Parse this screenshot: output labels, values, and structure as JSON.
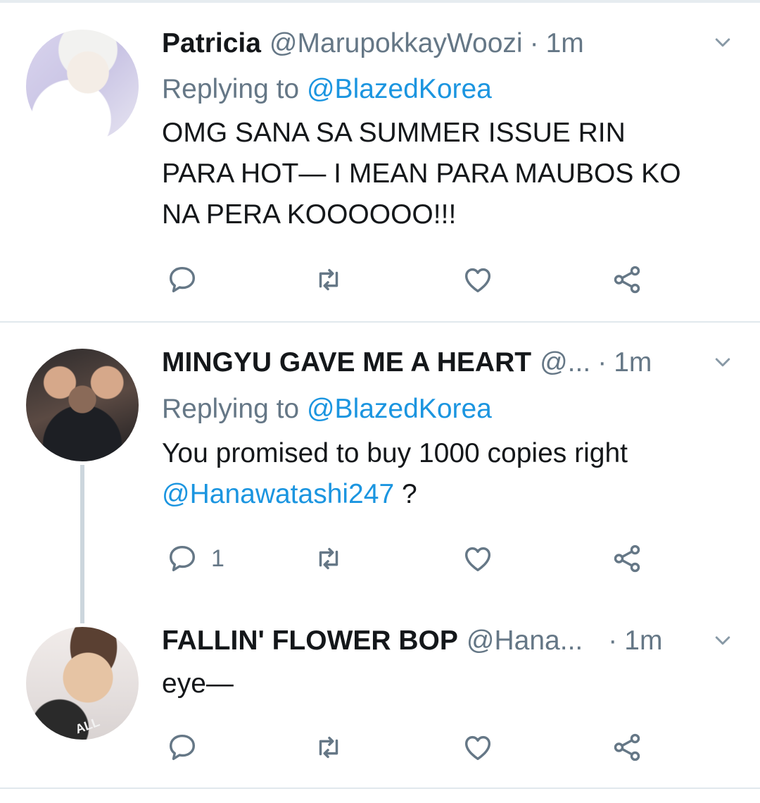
{
  "tweets": [
    {
      "name": "Patricia",
      "handle": "@MarupokkayWoozi",
      "time": "1m",
      "replying_prefix": "Replying to",
      "replying_to": "@BlazedKorea",
      "text_lines": [
        "OMG SANA SA SUMMER ISSUE RIN",
        "PARA HOT— I MEAN PARA MAUBOS KO",
        "NA PERA KOOOOOO!!!"
      ],
      "reply_count": ""
    },
    {
      "name": "MINGYU GAVE ME A HEART",
      "handle": "@...",
      "time": "1m",
      "replying_prefix": "Replying to",
      "replying_to": "@BlazedKorea",
      "text_line1": "You promised to buy 1000 copies right",
      "mention": "@Hanawatashi247",
      "text_line2_suffix": " ?",
      "reply_count": "1"
    },
    {
      "name": "FALLIN' FLOWER BOP",
      "handle": "@Hana...",
      "time": "1m",
      "text": "eye—",
      "reply_count": ""
    }
  ],
  "separator": "·",
  "icons": {
    "reply": "reply-icon",
    "retweet": "retweet-icon",
    "like": "heart-icon",
    "share": "share-icon",
    "menu": "chevron-down-icon"
  },
  "colors": {
    "link": "#1b95e0",
    "secondary_text": "#657786",
    "divider": "#e1e8ed",
    "thread_line": "#ccd6dd"
  }
}
